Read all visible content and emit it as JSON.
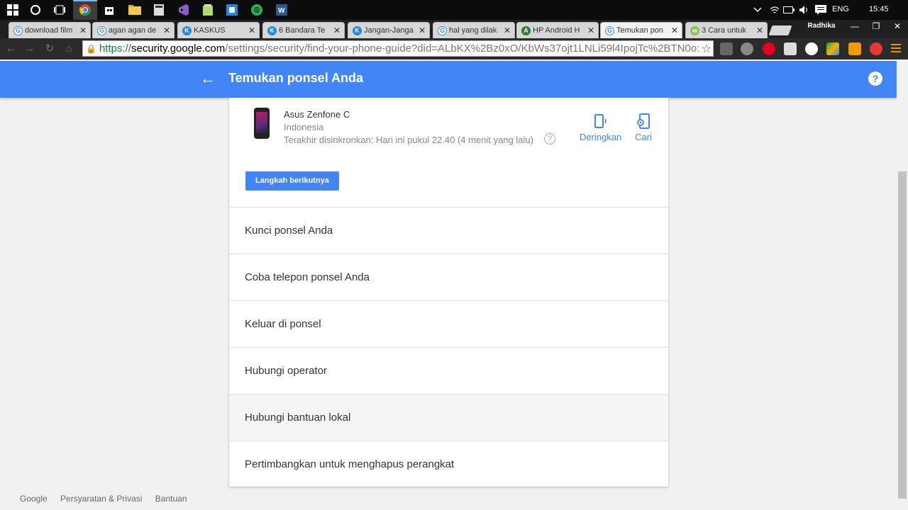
{
  "taskbar": {
    "language": "ENG",
    "time": "15:45"
  },
  "browser": {
    "profile": "Radhika",
    "tabs": [
      {
        "label": "download film",
        "icon": "google-icon",
        "active": false
      },
      {
        "label": "agan agan de",
        "icon": "google-icon",
        "active": false
      },
      {
        "label": "KASKUS",
        "icon": "kaskus-icon",
        "active": false
      },
      {
        "label": "6 Bandara Te",
        "icon": "kaskus-icon",
        "active": false
      },
      {
        "label": "Jangan-Janga",
        "icon": "kaskus-icon",
        "active": false
      },
      {
        "label": "hal yang dilak",
        "icon": "google-icon",
        "active": false
      },
      {
        "label": "HP Android H",
        "icon": "android-icon",
        "active": false
      },
      {
        "label": "Temukan pon",
        "icon": "google-icon",
        "active": true
      },
      {
        "label": "3 Cara untuk",
        "icon": "wikihow-icon",
        "active": false
      }
    ],
    "url": {
      "scheme": "https://",
      "host": "security.google.com",
      "path": "/settings/security/find-your-phone-guide?did=ALbKX%2Bz0xO/KbWs37ojt1LNLi59l4IpojTc%2BTN0o:"
    }
  },
  "header": {
    "title": "Temukan ponsel Anda",
    "help": "?"
  },
  "device": {
    "name": "Asus Zenfone C",
    "country": "Indonesia",
    "last_sync": "Terakhir disinkronkan: Hari ini pukul 22.40 (4 menit yang lalu)",
    "actions": {
      "ring": "Deringkan",
      "locate": "Cari"
    }
  },
  "next_button": "Langkah berikutnya",
  "options": [
    "Kunci ponsel Anda",
    "Coba telepon ponsel Anda",
    "Keluar di ponsel",
    "Hubungi operator",
    "Hubungi bantuan lokal",
    "Pertimbangkan untuk menghapus perangkat"
  ],
  "footer": {
    "brand": "Google",
    "privacy": "Persyaratan & Privasi",
    "help": "Bantuan"
  },
  "colors": {
    "accent": "#4285f4",
    "secure_url": "#0b8043"
  }
}
